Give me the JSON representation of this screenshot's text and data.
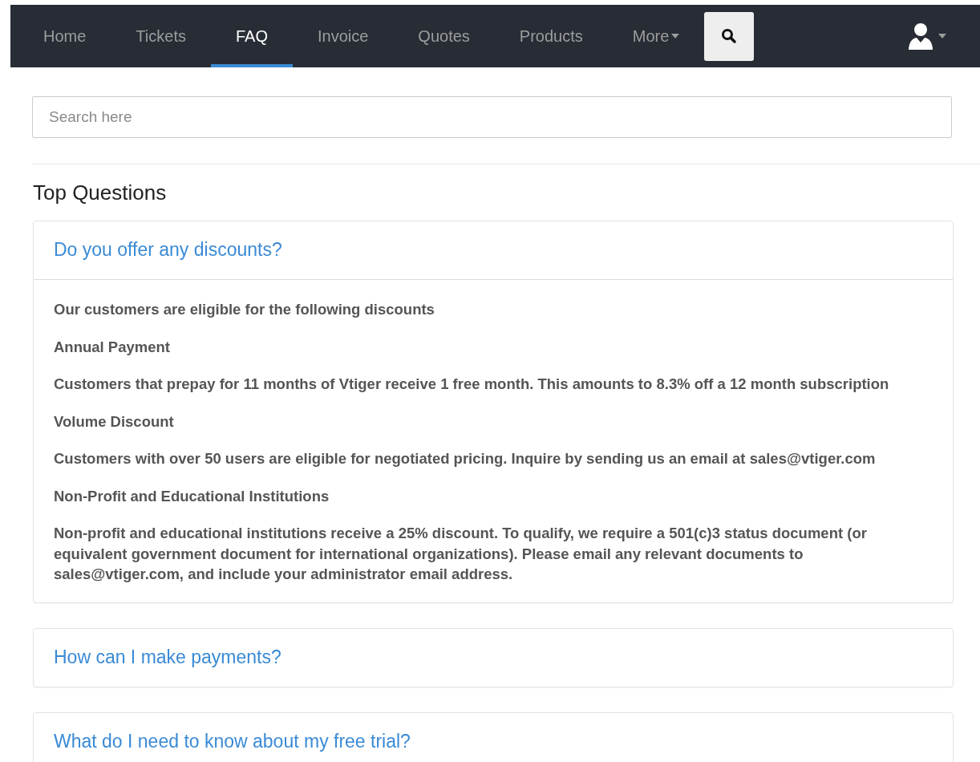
{
  "nav": {
    "items": [
      {
        "label": "Home",
        "selected": false,
        "kind": "link"
      },
      {
        "label": "Tickets",
        "selected": false,
        "kind": "link"
      },
      {
        "label": "FAQ",
        "selected": true,
        "kind": "link"
      },
      {
        "label": "Invoice",
        "selected": false,
        "kind": "link"
      },
      {
        "label": "Quotes",
        "selected": false,
        "kind": "link"
      },
      {
        "label": "Products",
        "selected": false,
        "kind": "link"
      },
      {
        "label": "More",
        "selected": false,
        "kind": "dropdown"
      }
    ]
  },
  "search": {
    "placeholder": "Search here"
  },
  "section_title": "Top Questions",
  "faqs": [
    {
      "question": "Do you offer any discounts?",
      "expanded": true,
      "answer": [
        "Our customers are eligible for the following discounts",
        "Annual Payment",
        "Customers that prepay for 11 months of Vtiger receive 1 free month. This amounts to 8.3% off a 12 month subscription",
        "Volume Discount",
        "Customers with over 50 users are eligible for negotiated pricing. Inquire by sending us an email at sales@vtiger.com",
        "Non-Profit and Educational Institutions",
        "Non-profit and educational institutions receive a 25% discount. To qualify, we require a 501(c)3 status document (or equivalent government document for international organizations). Please email any relevant documents to sales@vtiger.com, and include your administrator email address."
      ]
    },
    {
      "question": "How can I make payments?",
      "expanded": false
    },
    {
      "question": "What do I need to know about my free trial?",
      "expanded": false
    }
  ]
}
